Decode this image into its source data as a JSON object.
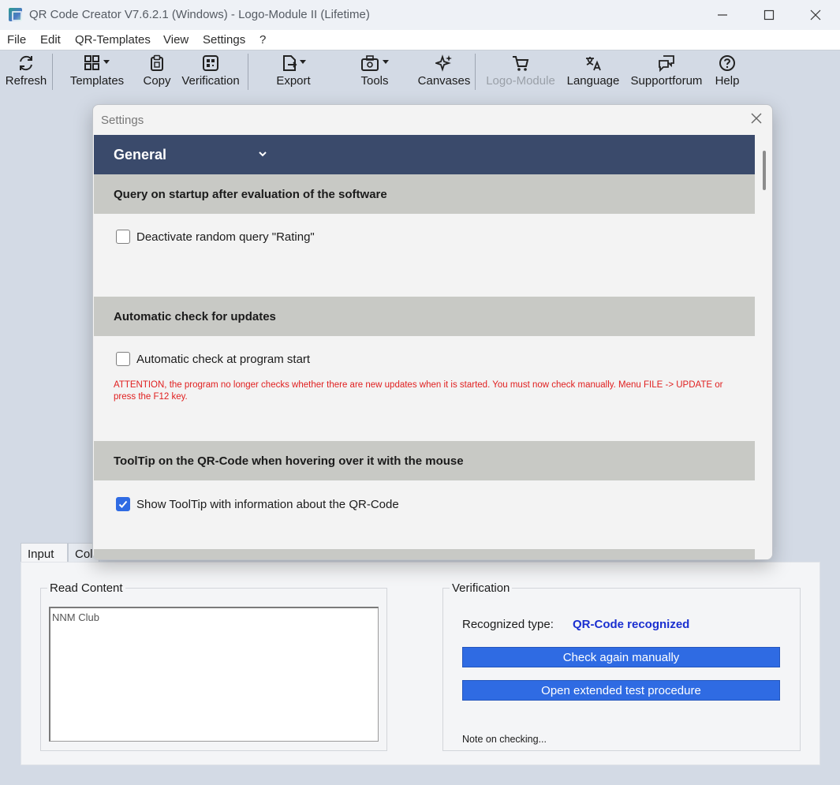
{
  "window": {
    "title": "QR Code Creator V7.6.2.1  (Windows) - Logo-Module II (Lifetime)",
    "minimize": "—",
    "maximize": "☐",
    "close": "✕"
  },
  "menu": [
    "File",
    "Edit",
    "QR-Templates",
    "View",
    "Settings",
    "?"
  ],
  "toolbar": {
    "refresh": "Refresh",
    "templates": "Templates",
    "copy": "Copy",
    "verification": "Verification",
    "export": "Export",
    "tools": "Tools",
    "canvases": "Canvases",
    "logo_module": "Logo-Module",
    "language": "Language",
    "supportforum": "Supportforum",
    "help": "Help"
  },
  "tabs": [
    "Input",
    "Col"
  ],
  "read_content": {
    "legend": "Read Content",
    "value": "NNM Club"
  },
  "verification": {
    "legend": "Verification",
    "recognized_label": "Recognized type:",
    "recognized_value": "QR-Code recognized",
    "check_again": "Check again manually",
    "extended": "Open extended test procedure",
    "note": "Note on checking..."
  },
  "settings": {
    "title": "Settings",
    "general": "General",
    "sections": [
      {
        "heading": "Query on startup after evaluation of the software",
        "option": "Deactivate random query \"Rating\"",
        "checked": false
      },
      {
        "heading": "Automatic check for updates",
        "option": "Automatic check at program start",
        "checked": false,
        "warning": "ATTENTION, the program no longer checks whether there are new updates when it is started. You must now check manually. Menu FILE -> UPDATE or press the F12 key."
      },
      {
        "heading": "ToolTip on the QR-Code when hovering over it with the mouse",
        "option": "Show ToolTip with information about the QR-Code",
        "checked": true
      }
    ]
  },
  "colors": {
    "accent": "#2f6be3",
    "header_bar": "#3a4a6b",
    "section_bar": "#c8c9c5",
    "warning": "#e02020",
    "recognized": "#1a2fd0"
  }
}
